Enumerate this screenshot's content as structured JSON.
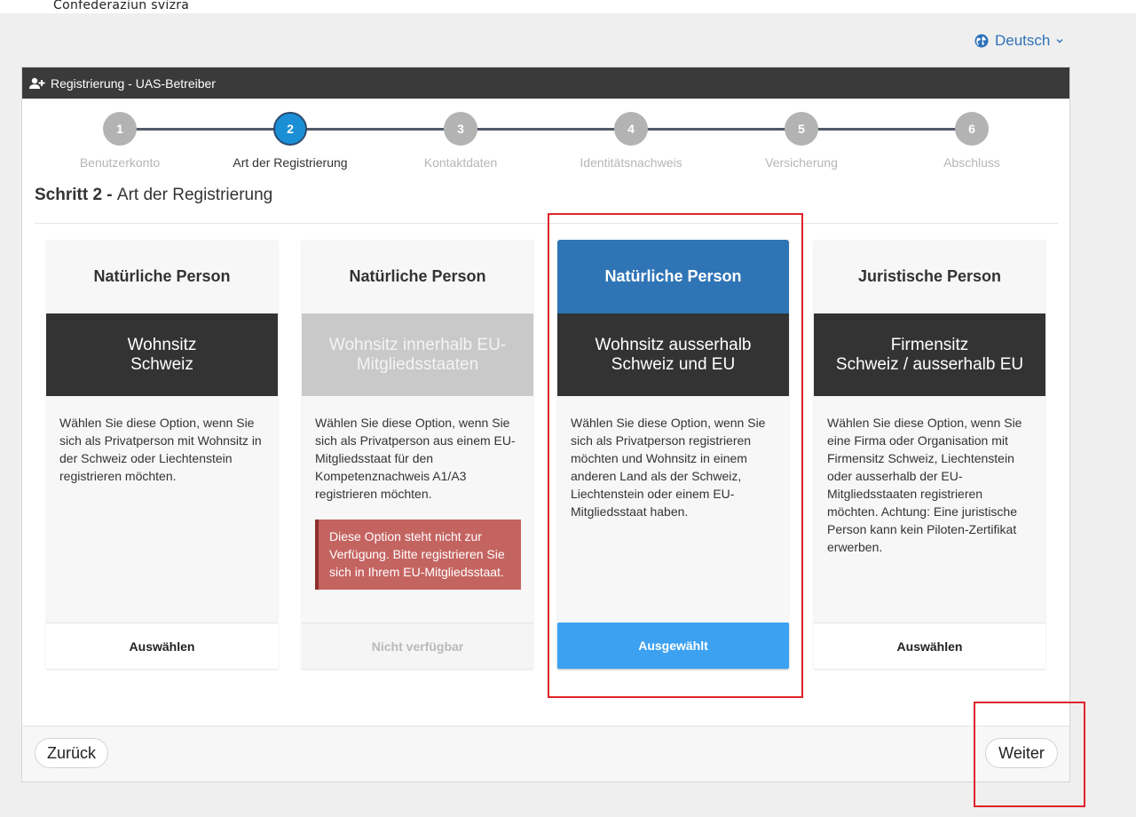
{
  "header": {
    "confederation_text": "Confederaziun svizra"
  },
  "language": {
    "label": "Deutsch"
  },
  "panel": {
    "title": "Registrierung - UAS-Betreiber"
  },
  "stepper": {
    "steps": [
      {
        "number": "1",
        "label": "Benutzerkonto",
        "state": "done"
      },
      {
        "number": "2",
        "label": "Art der Registrierung",
        "state": "active"
      },
      {
        "number": "3",
        "label": "Kontaktdaten",
        "state": "pending"
      },
      {
        "number": "4",
        "label": "Identitätsnachweis",
        "state": "pending"
      },
      {
        "number": "5",
        "label": "Versicherung",
        "state": "pending"
      },
      {
        "number": "6",
        "label": "Abschluss",
        "state": "pending"
      }
    ]
  },
  "step_heading": {
    "prefix": "Schritt 2",
    "separator": " - ",
    "title": "Art der Registrierung"
  },
  "cards": [
    {
      "title": "Natürliche Person",
      "band_line1": "Wohnsitz",
      "band_line2": "Schweiz",
      "description": "Wählen Sie diese Option, wenn Sie sich als Privatperson mit Wohnsitz in der Schweiz oder Liechtenstein registrieren möchten.",
      "button": "Auswählen",
      "state": "available"
    },
    {
      "title": "Natürliche Person",
      "band_line1": "Wohnsitz innerhalb EU-",
      "band_line2": "Mitgliedsstaaten",
      "description": "Wählen Sie diese Option, wenn Sie sich als Privatperson aus einem EU-Mitgliedsstaat für den Kompetenznachweis A1/A3 registrieren möchten.",
      "alert": "Diese Option steht nicht zur Verfügung. Bitte registrieren Sie sich in Ihrem EU-Mitgliedsstaat.",
      "button": "Nicht verfügbar",
      "state": "disabled"
    },
    {
      "title": "Natürliche Person",
      "band_line1": "Wohnsitz ausserhalb",
      "band_line2": "Schweiz und EU",
      "description": "Wählen Sie diese Option, wenn Sie sich als Privatperson registrieren möchten und Wohnsitz in einem anderen Land als der Schweiz, Liechtenstein oder einem EU-Mitgliedsstaat haben.",
      "button": "Ausgewählt",
      "state": "selected"
    },
    {
      "title": "Juristische Person",
      "band_line1": "Firmensitz",
      "band_line2": "Schweiz / ausserhalb EU",
      "description": "Wählen Sie diese Option, wenn Sie eine Firma oder Organisation mit Firmensitz Schweiz, Liechtenstein oder ausserhalb der EU-Mitgliedsstaaten registrieren möchten. Achtung: Eine juristische Person kann kein Piloten-Zertifikat erwerben.",
      "button": "Auswählen",
      "state": "available"
    }
  ],
  "footer": {
    "back_label": "Zurück",
    "next_label": "Weiter"
  },
  "colors": {
    "accent": "#2f74b5",
    "active_step": "#1a8fd6",
    "selected_button": "#3ca1f1",
    "alert": "#c46461",
    "highlight_box": "#e0242a"
  },
  "icons": {
    "language": "globe-icon",
    "dropdown": "chevron-down-icon",
    "panel_header": "add-user-icon"
  }
}
